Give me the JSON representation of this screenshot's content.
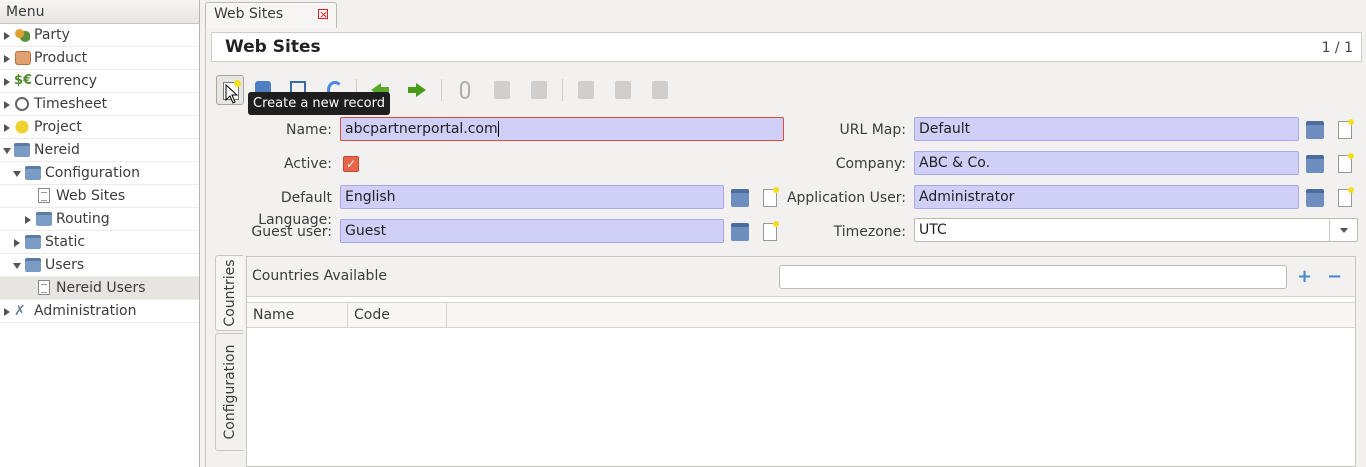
{
  "sidebar": {
    "header": "Menu",
    "items": [
      {
        "label": "Party"
      },
      {
        "label": "Product"
      },
      {
        "label": "Currency"
      },
      {
        "label": "Timesheet"
      },
      {
        "label": "Project"
      },
      {
        "label": "Nereid"
      },
      {
        "label": "Configuration"
      },
      {
        "label": "Web Sites"
      },
      {
        "label": "Routing"
      },
      {
        "label": "Static"
      },
      {
        "label": "Users"
      },
      {
        "label": "Nereid Users"
      },
      {
        "label": "Administration"
      }
    ]
  },
  "tabs": [
    {
      "label": "Web Sites"
    }
  ],
  "header": {
    "title": "Web Sites",
    "record_count": "1 / 1"
  },
  "toolbar": {
    "tooltip": "Create a new record"
  },
  "form": {
    "name_label": "Name:",
    "name_value": "abcpartnerportal.com",
    "active_label": "Active:",
    "default_language_label": "Default Language:",
    "default_language_value": "English",
    "guest_user_label": "Guest user:",
    "guest_user_value": "Guest",
    "url_map_label": "URL Map:",
    "url_map_value": "Default",
    "company_label": "Company:",
    "company_value": "ABC & Co.",
    "application_user_label": "Application User:",
    "application_user_value": "Administrator",
    "timezone_label": "Timezone:",
    "timezone_value": "UTC"
  },
  "notebook": {
    "tabs": [
      {
        "label": "Countries"
      },
      {
        "label": "Configuration"
      }
    ],
    "panel_title": "Countries Available",
    "add_symbol": "+",
    "remove_symbol": "−",
    "columns": [
      {
        "label": "Name"
      },
      {
        "label": "Code"
      }
    ]
  }
}
